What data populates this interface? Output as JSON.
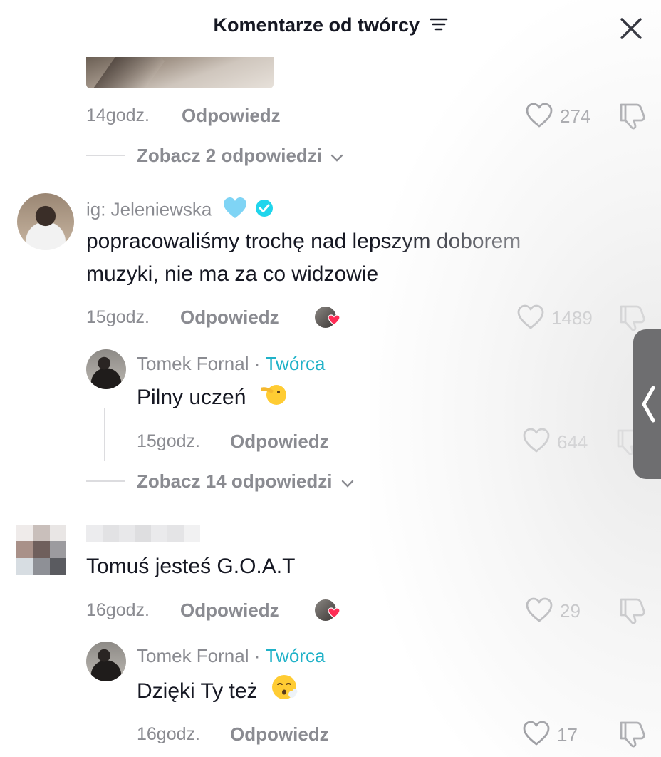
{
  "header": {
    "title": "Komentarze od twórcy",
    "filter_icon": "filter-lines-icon",
    "close_icon": "close-x-icon"
  },
  "colors": {
    "creator_accent": "#20b2c8",
    "meta_gray": "#8a8b91",
    "text": "#161823",
    "heart_red": "#fe2c55"
  },
  "comments": [
    {
      "time": "14godz.",
      "reply_label": "Odpowiedz",
      "likes": "274",
      "view_replies": "Zobacz 2 odpowiedzi"
    },
    {
      "username": "ig: Jeleniewska",
      "badges": [
        "light-blue-heart-emoji",
        "verified-check-icon"
      ],
      "text_line1": "popracowaliśmy trochę nad lepszym doborem",
      "text_line2": "muzyki, nie ma za co widzowie",
      "time": "15godz.",
      "reply_label": "Odpowiedz",
      "likes": "1489",
      "reply": {
        "username": "Tomek Fornal",
        "sep": " · ",
        "role": "Twórca",
        "text": "Pilny uczeń",
        "emoji": "face-peeking-emoji",
        "time": "15godz.",
        "reply_label": "Odpowiedz",
        "likes": "644"
      },
      "view_replies": "Zobacz 14 odpowiedzi"
    },
    {
      "text": "Tomuś jesteś G.O.A.T",
      "time": "16godz.",
      "reply_label": "Odpowiedz",
      "likes": "29",
      "reply": {
        "username": "Tomek Fornal",
        "sep": " · ",
        "role": "Twórca",
        "text": "Dzięki Ty też",
        "emoji": "face-exhaling-emoji",
        "time": "16godz.",
        "reply_label": "Odpowiedz",
        "likes": "17"
      }
    }
  ]
}
